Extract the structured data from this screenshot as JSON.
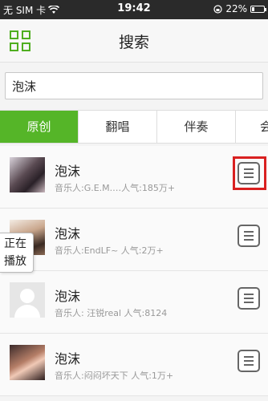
{
  "status_bar": {
    "carrier": "无 SIM 卡",
    "wifi_icon": "wifi-icon",
    "time": "19:42",
    "lock_icon": "rotation-lock-icon",
    "battery": "22%",
    "battery_level": 0.22
  },
  "header": {
    "menu_icon": "grid-menu-icon",
    "title": "搜索"
  },
  "search": {
    "value": "泡沫",
    "placeholder": ""
  },
  "tabs": [
    {
      "label": "原创",
      "active": true
    },
    {
      "label": "翻唱",
      "active": false
    },
    {
      "label": "伴奏",
      "active": false
    },
    {
      "label": "会",
      "active": false
    }
  ],
  "results": [
    {
      "title": "泡沫",
      "meta": "音乐人:G.E.M.…人气:185万+",
      "highlighted": true
    },
    {
      "title": "泡沫",
      "meta": "音乐人:EndLF~  人气:2万+",
      "highlighted": false
    },
    {
      "title": "泡沫",
      "meta": "音乐人: 汪锐real  人气:8124",
      "highlighted": false
    },
    {
      "title": "泡沫",
      "meta": "音乐人:闷闷坏天下  人气:1万+",
      "highlighted": false
    }
  ],
  "now_playing": {
    "line1": "正在",
    "line2": "播放"
  },
  "colors": {
    "accent": "#55b528",
    "highlight": "#d92020"
  }
}
